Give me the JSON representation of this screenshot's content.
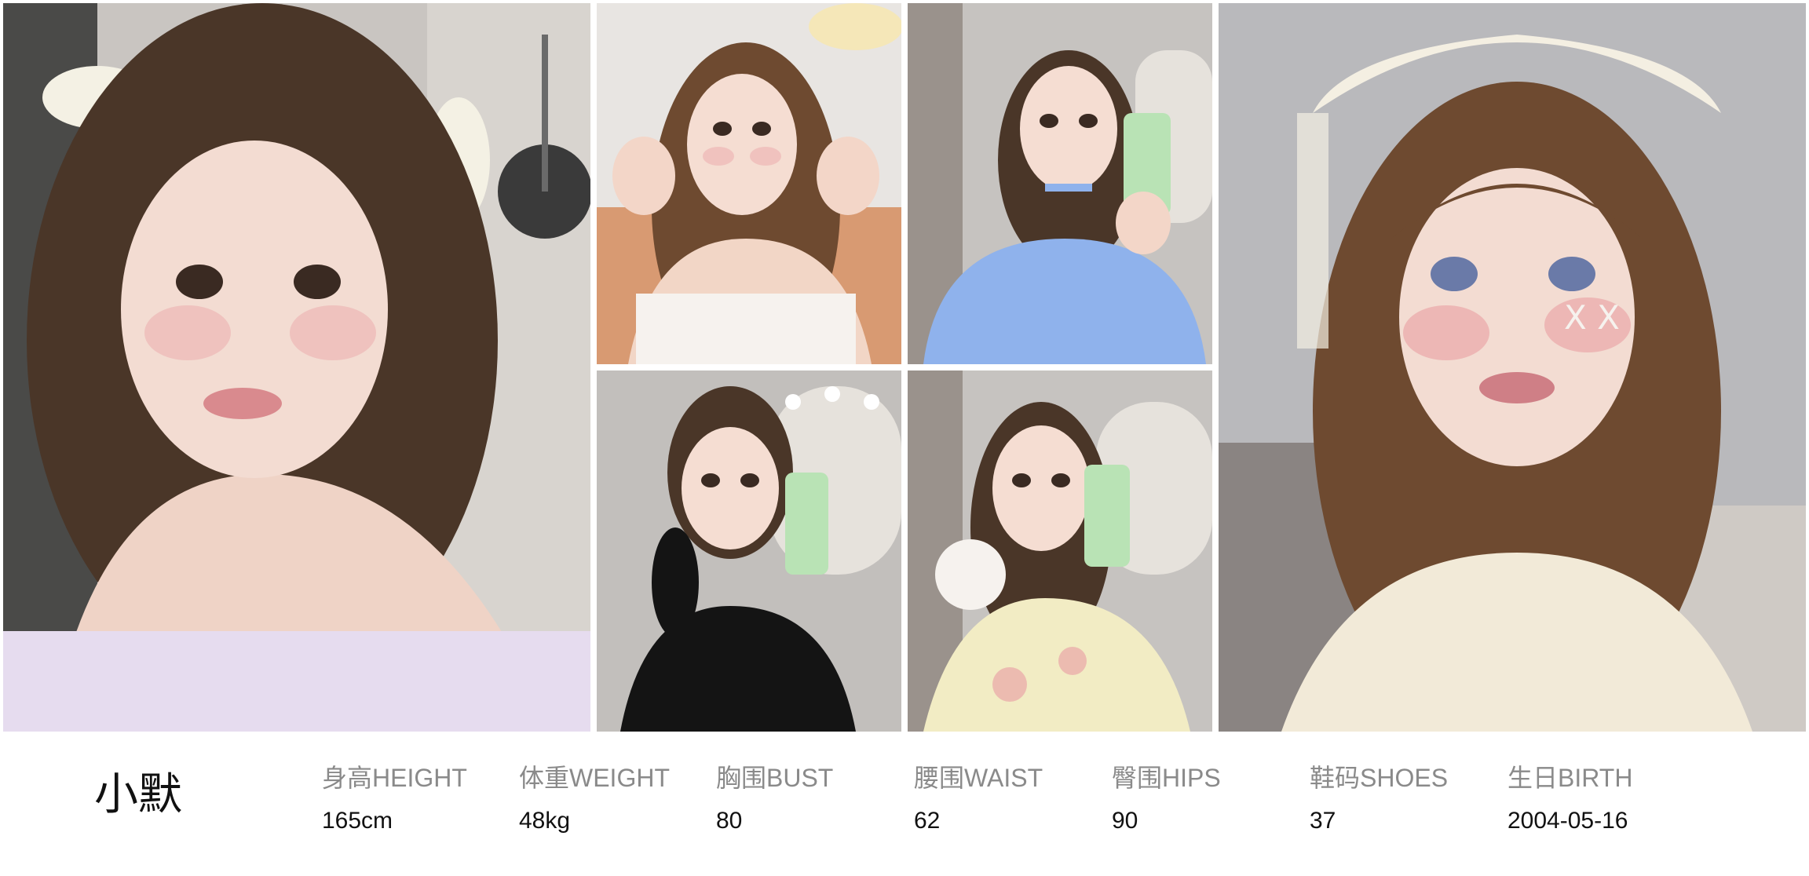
{
  "profile": {
    "name": "小默",
    "stats": [
      {
        "label": "身高HEIGHT",
        "value": "165cm"
      },
      {
        "label": "体重WEIGHT",
        "value": "48kg"
      },
      {
        "label": "胸围BUST",
        "value": "80"
      },
      {
        "label": "腰围WAIST",
        "value": "62"
      },
      {
        "label": "臀围HIPS",
        "value": "90"
      },
      {
        "label": "鞋码SHOES",
        "value": "37"
      },
      {
        "label": "生日BIRTH",
        "value": "2004-05-16"
      }
    ]
  },
  "colors": {
    "hair_dark": "#4a3628",
    "hair_brown": "#6e4a30",
    "skin": "#f3d9cf",
    "blush": "#e9a6a8",
    "dress_lavender": "#e6dcef",
    "dress_white": "#f6f2ee",
    "dress_blue": "#8fb2ec",
    "dress_black": "#141414",
    "dress_floral": "#f2ecc4",
    "phone_case": "#b9e3b5",
    "bg_salon": "#c7c3c0",
    "bg_wall": "#d9d6d4",
    "bg_grey": "#b8b8bb"
  }
}
